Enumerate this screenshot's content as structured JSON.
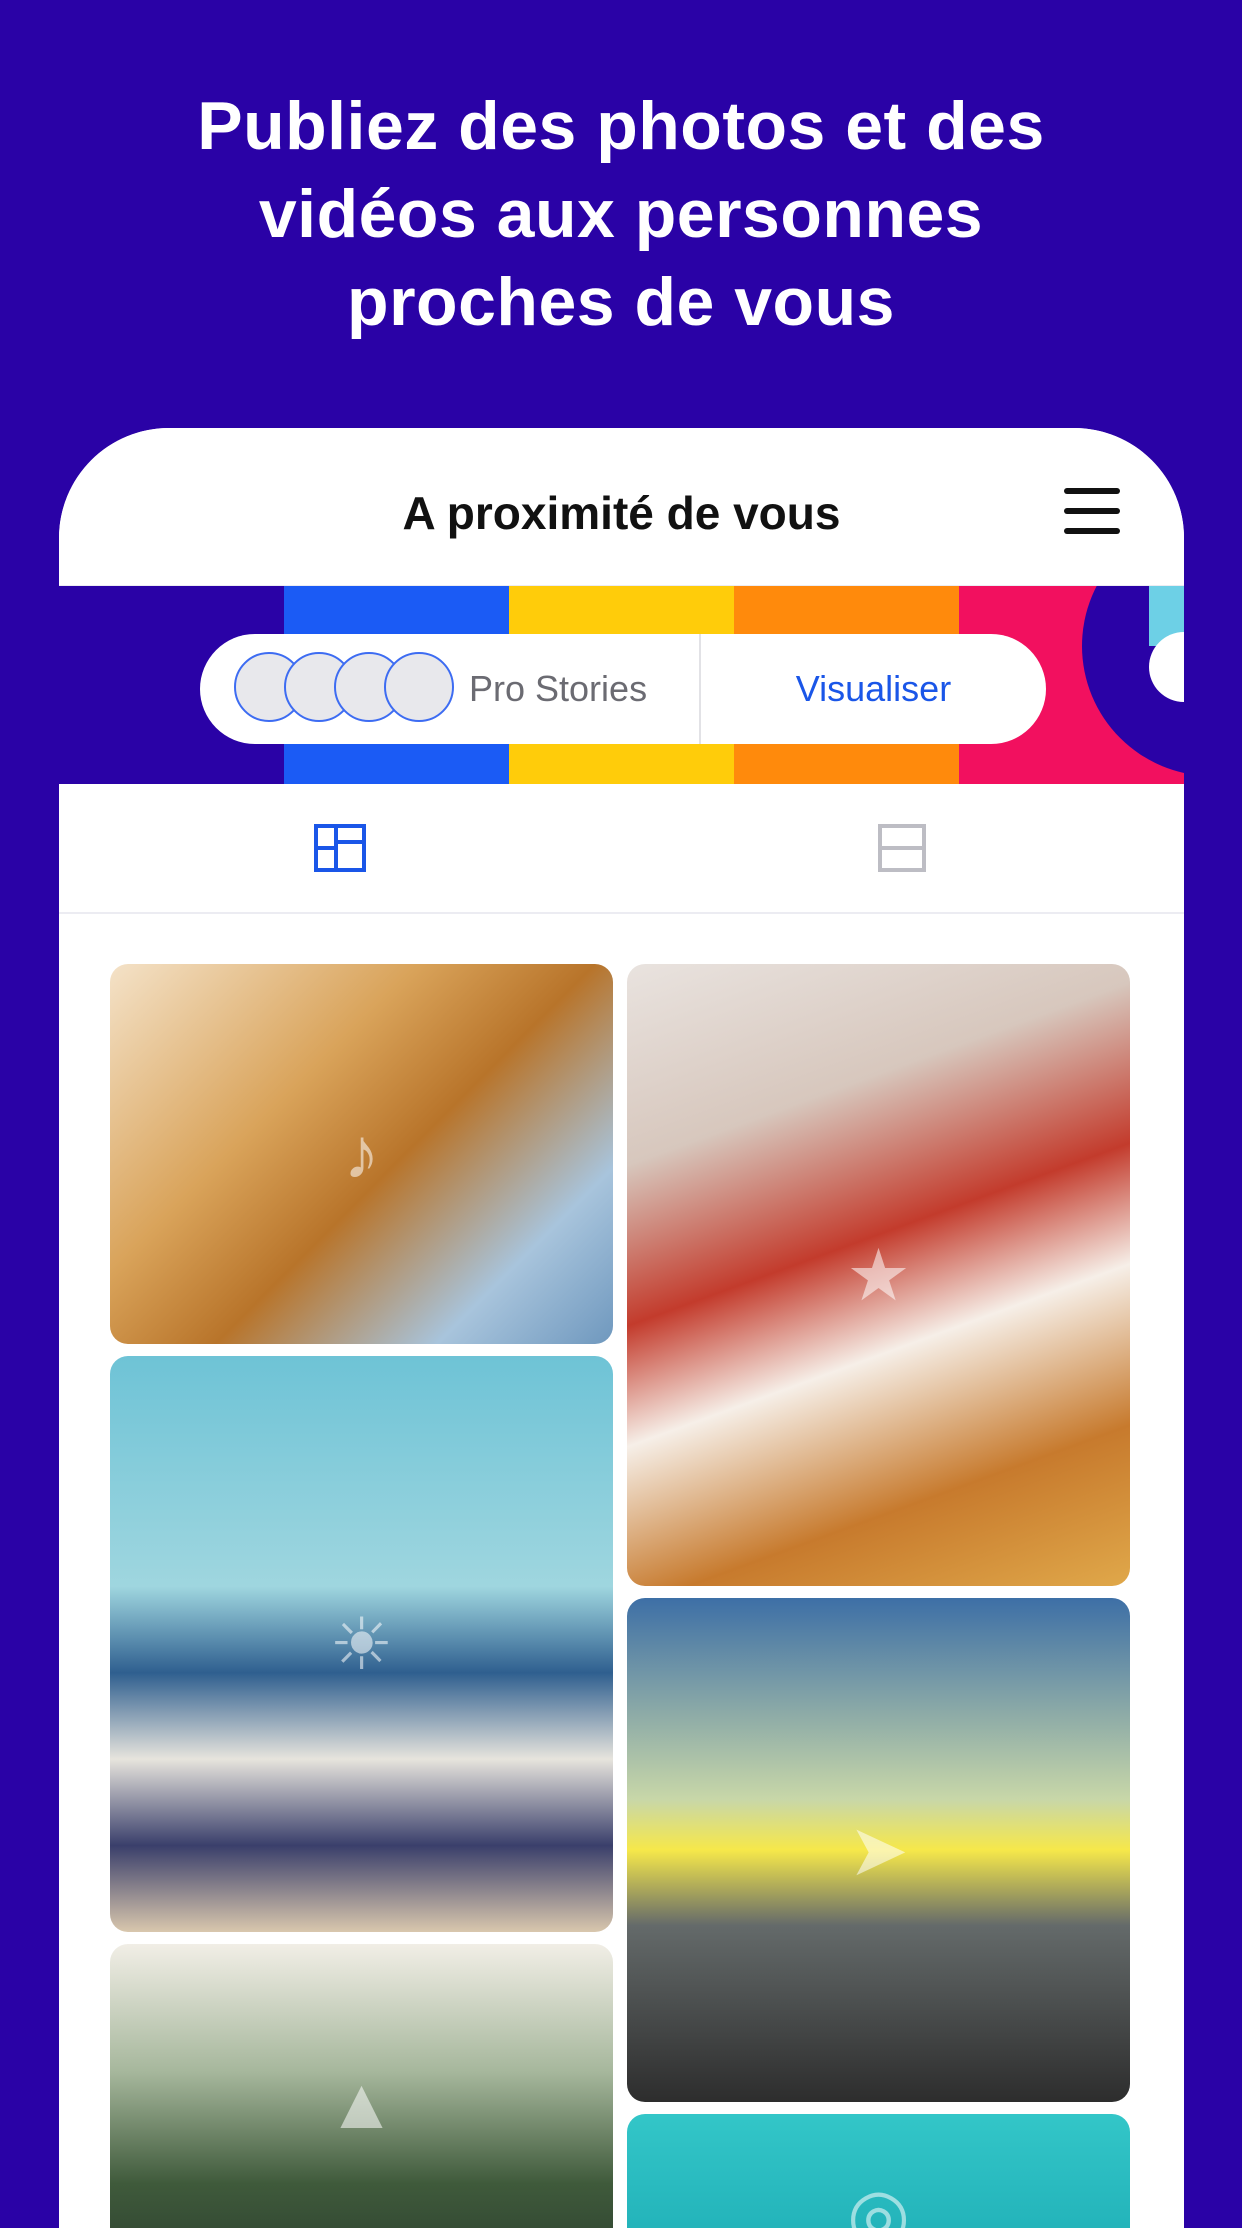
{
  "headline": {
    "line1": "Publiez des photos et des",
    "line2": "vidéos aux personnes",
    "line3": "proches de vous"
  },
  "header": {
    "title": "A proximité de vous",
    "menu_icon": "hamburger-menu-icon"
  },
  "stories": {
    "label": "Pro Stories",
    "view_button": "Visualiser",
    "avatar_count": 4
  },
  "tabs": [
    {
      "icon": "mosaic-grid-icon",
      "active": true
    },
    {
      "icon": "single-list-icon",
      "active": false
    }
  ],
  "feed": [
    {
      "subject": "guitar-photo"
    },
    {
      "subject": "christmas-party-photo"
    },
    {
      "subject": "beach-family-photo"
    },
    {
      "subject": "motorcycle-road-photo"
    },
    {
      "subject": "forest-photo"
    },
    {
      "subject": "underwater-camera-photo"
    }
  ],
  "colors": {
    "background": "#2a02a6",
    "accent": "#1a56e8",
    "stripe_blue": "#1b5bf5",
    "stripe_yellow": "#ffcc0a",
    "stripe_orange": "#ff8a0c",
    "stripe_pink": "#f2105f"
  }
}
